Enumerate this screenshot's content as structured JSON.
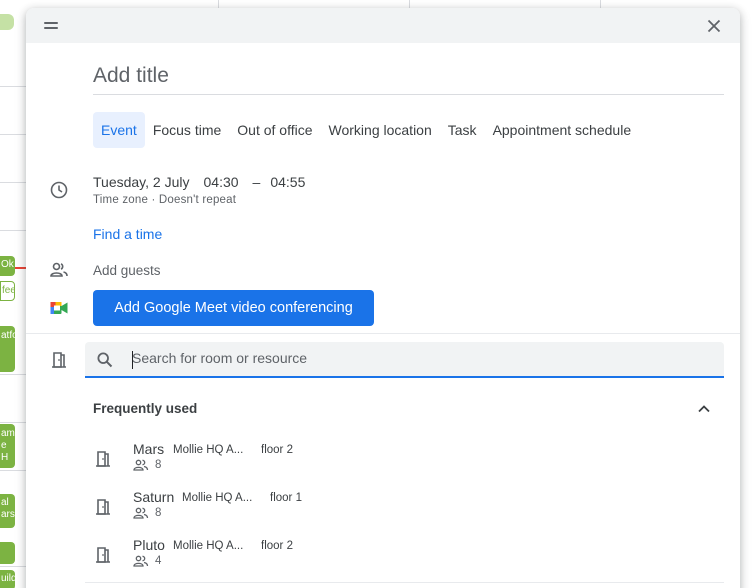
{
  "background": {
    "chips": [
      "Ok",
      "fee",
      "atfo",
      "am e H",
      "al ars",
      "uild"
    ]
  },
  "dialog": {
    "title_placeholder": "Add title",
    "tabs": [
      {
        "label": "Event",
        "active": true
      },
      {
        "label": "Focus time",
        "active": false
      },
      {
        "label": "Out of office",
        "active": false
      },
      {
        "label": "Working location",
        "active": false
      },
      {
        "label": "Task",
        "active": false
      },
      {
        "label": "Appointment schedule",
        "active": false
      }
    ],
    "date": "Tuesday, 2 July",
    "start_time": "04:30",
    "dash": "–",
    "end_time": "04:55",
    "timezone": "Time zone",
    "dot": "·",
    "repeat": "Doesn't repeat",
    "find_time": "Find a time",
    "add_guests": "Add guests",
    "meet_button": "Add Google Meet video conferencing",
    "search_placeholder": "Search for room or resource",
    "frequently_used": "Frequently used",
    "rooms": [
      {
        "name": "Mars",
        "building": "Mollie HQ A...",
        "floor": "floor 2",
        "capacity": "8"
      },
      {
        "name": "Saturn",
        "building": "Mollie HQ A...",
        "floor": "floor 1",
        "capacity": "8"
      },
      {
        "name": "Pluto",
        "building": "Mollie HQ A...",
        "floor": "floor 2",
        "capacity": "4"
      }
    ],
    "colors": {
      "accent": "#1a73e8",
      "tab_active_bg": "#e8f0fe",
      "event_green": "#7cb342"
    }
  }
}
